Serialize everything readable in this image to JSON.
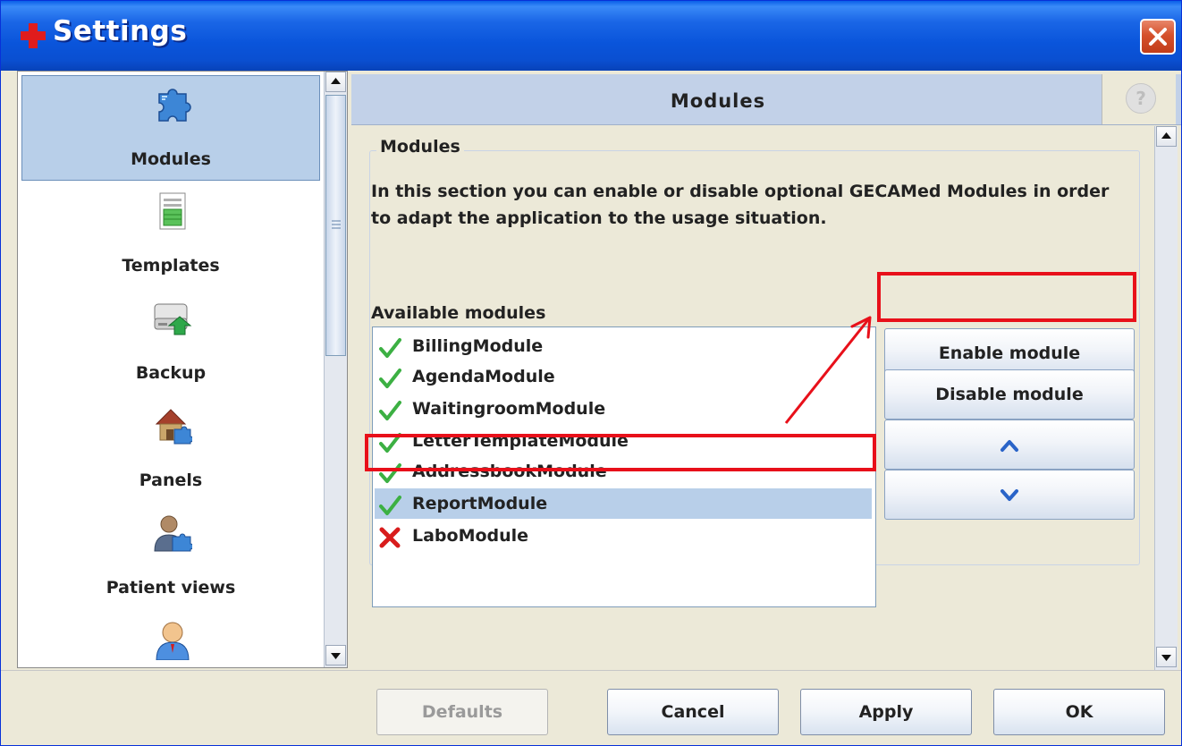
{
  "window": {
    "title": "Settings"
  },
  "sidebar": {
    "items": [
      {
        "label": "Modules",
        "icon": "puzzle-icon",
        "selected": true
      },
      {
        "label": "Templates",
        "icon": "document-icon",
        "selected": false
      },
      {
        "label": "Backup",
        "icon": "drive-backup-icon",
        "selected": false
      },
      {
        "label": "Panels",
        "icon": "house-puzzle-icon",
        "selected": false
      },
      {
        "label": "Patient views",
        "icon": "person-puzzle-icon",
        "selected": false
      },
      {
        "label": "",
        "icon": "user-icon",
        "selected": false
      }
    ]
  },
  "header": {
    "title": "Modules",
    "help": "?"
  },
  "section": {
    "legend": "Modules",
    "description": "In this section you can enable or disable optional GECAMed Modules in order to adapt the application to the usage situation.",
    "available_label": "Available modules",
    "modules": [
      {
        "name": "BillingModule",
        "enabled": true,
        "selected": false
      },
      {
        "name": "AgendaModule",
        "enabled": true,
        "selected": false
      },
      {
        "name": "WaitingroomModule",
        "enabled": true,
        "selected": false
      },
      {
        "name": "LetterTemplateModule",
        "enabled": true,
        "selected": false
      },
      {
        "name": "AddressbookModule",
        "enabled": true,
        "selected": false
      },
      {
        "name": "ReportModule",
        "enabled": true,
        "selected": true
      },
      {
        "name": "LaboModule",
        "enabled": false,
        "selected": false
      }
    ],
    "buttons": {
      "enable": "Enable module",
      "disable": "Disable module",
      "up_icon": "chevron-up-icon",
      "down_icon": "chevron-down-icon"
    }
  },
  "footer": {
    "defaults": "Defaults",
    "cancel": "Cancel",
    "apply": "Apply",
    "ok": "OK"
  },
  "colors": {
    "title_bar": "#0a55db",
    "selection": "#b8cfe9",
    "annotation": "#e8101a",
    "check": "#3cb043",
    "cross": "#d81c1c"
  }
}
